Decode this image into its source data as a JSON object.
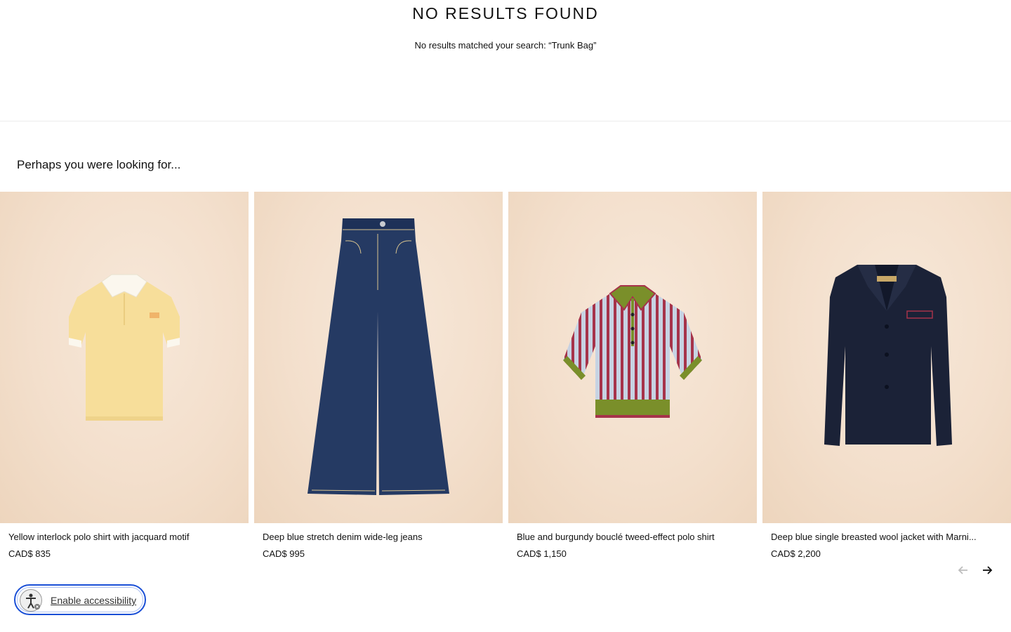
{
  "header": {
    "title": "NO RESULTS FOUND",
    "message": "No results matched your search: “Trunk Bag”"
  },
  "suggestions": {
    "heading": "Perhaps you were looking for...",
    "products": [
      {
        "name": "Yellow interlock polo shirt with jacquard motif",
        "price": "CAD$ 835"
      },
      {
        "name": "Deep blue stretch denim wide-leg jeans",
        "price": "CAD$ 995"
      },
      {
        "name": "Blue and burgundy bouclé tweed-effect polo shirt",
        "price": "CAD$ 1,150"
      },
      {
        "name": "Deep blue single breasted wool jacket with Marni...",
        "price": "CAD$ 2,200"
      }
    ]
  },
  "carousel_controls": {
    "prev_icon": "arrow-left-icon",
    "next_icon": "arrow-right-icon"
  },
  "accessibility": {
    "label": "Enable accessibility",
    "icon": "accessibility-person-icon"
  },
  "colors": {
    "accent": "#1a4fd6",
    "background": "#ffffff",
    "product_bg": "#f3dfcc"
  }
}
